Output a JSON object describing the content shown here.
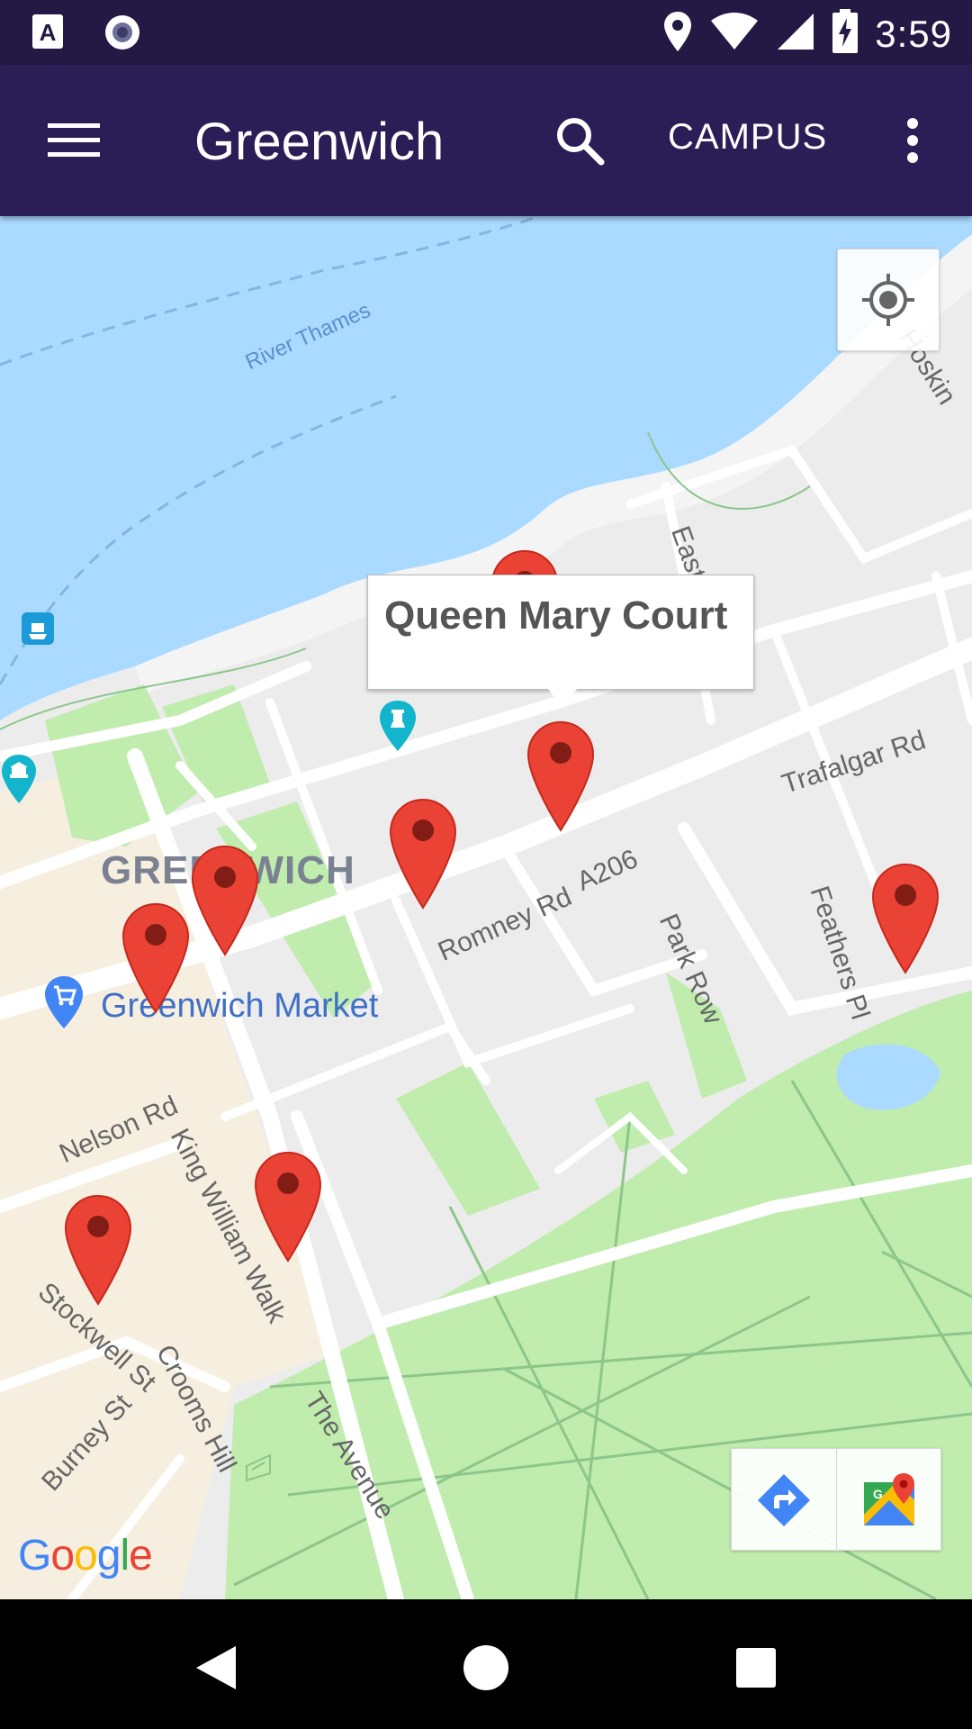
{
  "status_bar": {
    "time": "3:59",
    "icons": [
      "text-recognition-icon",
      "record-icon",
      "location-icon",
      "wifi-icon",
      "signal-icon",
      "battery-charging-icon"
    ]
  },
  "app_bar": {
    "title": "Greenwich",
    "campus_label": "CAMPUS",
    "icons": [
      "menu-icon",
      "search-icon",
      "more-vert-icon"
    ]
  },
  "map": {
    "info_window": {
      "title": "Queen Mary Court"
    },
    "labels": {
      "river": "River Thames",
      "area": "GREENWICH",
      "market": "Greenwich Market",
      "trafalgar": "Trafalgar Rd",
      "romney": "Romney Rd",
      "a206": "A206",
      "park_row": "Park Row",
      "feathers": "Feathers Pl",
      "nelson": "Nelson Rd",
      "king_william": "King William Walk",
      "stockwell": "Stockwell St",
      "crooms": "Crooms Hill",
      "burney": "Burney St",
      "avenue": "The Avenue",
      "east": "East",
      "hoskin": "Hoskin"
    },
    "marker_color": "#ea4335",
    "water_color": "#aadaff",
    "park_color": "#c0ecae",
    "google_logo": "Google"
  },
  "toolbar": {
    "icons": [
      "directions-icon",
      "google-maps-icon"
    ]
  },
  "nav_bar": {
    "icons": [
      "back-icon",
      "home-icon",
      "recents-icon"
    ]
  }
}
